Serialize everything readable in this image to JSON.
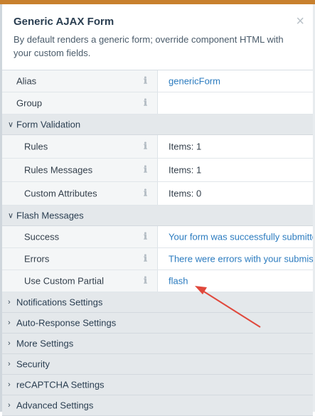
{
  "window": {
    "title": "Generic AJAX Form",
    "description": "By default renders a generic form; override component HTML with your custom fields.",
    "close_icon": "×"
  },
  "info_icon": "ℹ",
  "rows": {
    "alias": {
      "label": "Alias",
      "value": "genericForm"
    },
    "group": {
      "label": "Group",
      "value": ""
    }
  },
  "form_validation": {
    "label": "Form Validation",
    "chevron": "∨",
    "rules": {
      "label": "Rules",
      "value": "Items: 1"
    },
    "rules_messages": {
      "label": "Rules Messages",
      "value": "Items: 1"
    },
    "custom_attributes": {
      "label": "Custom Attributes",
      "value": "Items: 0"
    }
  },
  "flash_messages": {
    "label": "Flash Messages",
    "chevron": "∨",
    "success": {
      "label": "Success",
      "value": "Your form was successfully submitted"
    },
    "errors": {
      "label": "Errors",
      "value": "There were errors with your submission"
    },
    "use_custom_partial": {
      "label": "Use Custom Partial",
      "value": "flash"
    }
  },
  "collapsed_groups": [
    {
      "label": "Notifications Settings",
      "chevron": "›"
    },
    {
      "label": "Auto-Response Settings",
      "chevron": "›"
    },
    {
      "label": "More Settings",
      "chevron": "›"
    },
    {
      "label": "Security",
      "chevron": "›"
    },
    {
      "label": "reCAPTCHA Settings",
      "chevron": "›"
    },
    {
      "label": "Advanced Settings",
      "chevron": "›"
    }
  ],
  "colors": {
    "accent_bar": "#c8802e",
    "link_value": "#2b7bbf",
    "annotation_arrow": "#e0483c"
  }
}
